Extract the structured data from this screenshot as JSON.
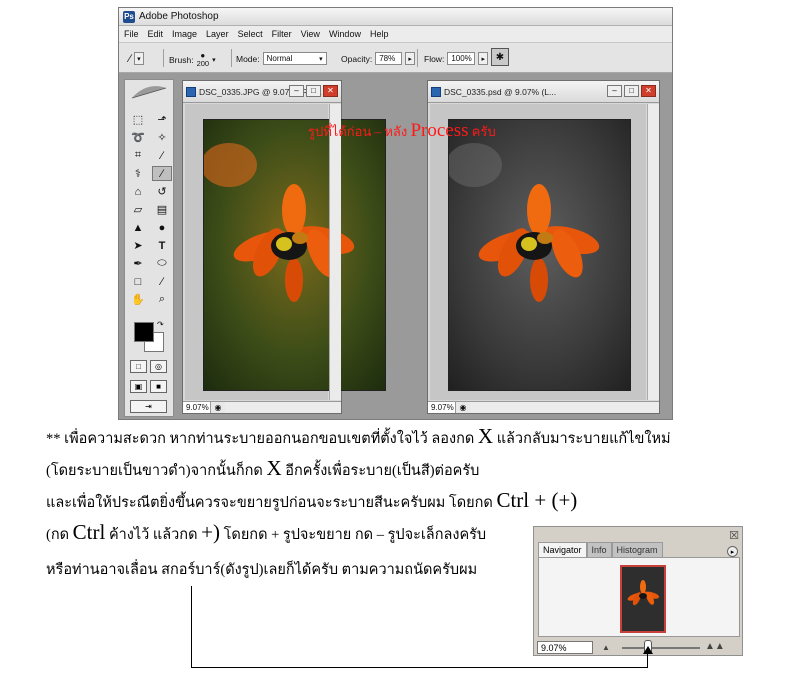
{
  "window": {
    "title": "Adobe Photoshop",
    "menu": [
      "File",
      "Edit",
      "Image",
      "Layer",
      "Select",
      "Filter",
      "View",
      "Window",
      "Help"
    ]
  },
  "options": {
    "brush_label": "Brush:",
    "brush_size": "200",
    "mode_label": "Mode:",
    "mode_value": "Normal",
    "opacity_label": "Opacity:",
    "opacity_value": "78%",
    "flow_label": "Flow:",
    "flow_value": "100%"
  },
  "doc_left": {
    "title": "DSC_0335.JPG @ 9.07% (RG...",
    "zoom": "9.07%"
  },
  "doc_right": {
    "title": "DSC_0335.psd @ 9.07% (L...",
    "zoom": "9.07%"
  },
  "overlay": {
    "part1": "รูปที่ได้ก่อน – หลัง",
    "part2": "Process",
    "part3": "ครับ"
  },
  "text": {
    "l1a": "** เพื่อความสะดวก หากท่านระบายออกนอกขอบเขตที่ตั้งใจไว้ ลองกด ",
    "l1b": "X",
    "l1c": " แล้วกลับมาระบายแก้ไขใหม่",
    "l2a": "(โดยระบายเป็นขาวดำ)จากนั้นก็กด ",
    "l2b": "X",
    "l2c": " อีกครั้งเพื่อระบาย(เป็นสี)ต่อครับ",
    "l3a": "และเพื่อให้ประณีตยิ่งขึ้นควรจะขยายรูปก่อนจะระบายสีนะครับผม โดยกด ",
    "l3b": "Ctrl + (+)",
    "l4a": "(กด ",
    "l4b": "Ctrl",
    "l4c": " ค้างไว้ แล้วกด ",
    "l4d": "+)",
    "l4e": " โดยกด + รูปจะขยาย กด – รูปจะเล็กลงครับ",
    "l5": "หรือท่านอาจเลื่อน สกอร์บาร์(ดังรูป)เลยก็ได้ครับ ตามความถนัดครับผม"
  },
  "navigator": {
    "tabs": [
      "Navigator",
      "Info",
      "Histogram"
    ],
    "zoom": "9.07%"
  },
  "colors": {
    "accent_red": "#ff1a1a",
    "flower": "#e8560c"
  }
}
